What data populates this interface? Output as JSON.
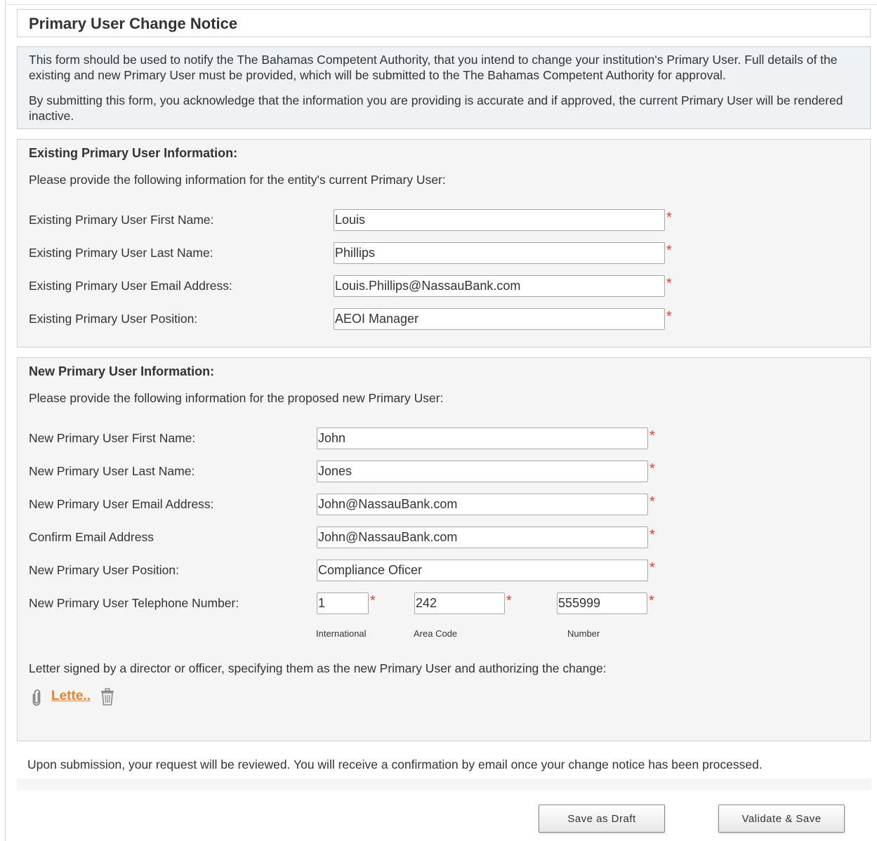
{
  "page_title": "Primary User Change Notice",
  "intro": {
    "para1": "This form should be used to notify the The Bahamas Competent Authority, that you intend to change your institution's Primary User. Full details of the existing and new Primary User must be provided, which will be submitted to the The Bahamas Competent Authority for approval.",
    "para2": "By submitting this form, you acknowledge that the information you are providing is accurate and if approved, the current Primary User will be rendered inactive."
  },
  "existing": {
    "heading": "Existing Primary User Information:",
    "instruction": "Please provide the following information for the entity's current Primary User:",
    "fields": [
      {
        "label": "Existing Primary User First Name:",
        "value": "Louis"
      },
      {
        "label": "Existing Primary User Last Name:",
        "value": "Phillips"
      },
      {
        "label": "Existing Primary User Email Address:",
        "value": "Louis.Phillips@NassauBank.com"
      },
      {
        "label": "Existing Primary User Position:",
        "value": "AEOI Manager"
      }
    ]
  },
  "new_user": {
    "heading": "New Primary User Information:",
    "instruction": "Please provide the following information for the proposed new Primary User:",
    "fields": [
      {
        "label": "New Primary User First Name:",
        "value": "John"
      },
      {
        "label": "New Primary User Last Name:",
        "value": "Jones"
      },
      {
        "label": "New Primary User Email Address:",
        "value": "John@NassauBank.com"
      },
      {
        "label": "Confirm Email Address",
        "value": "John@NassauBank.com"
      },
      {
        "label": "New Primary User Position:",
        "value": "Compliance Oficer"
      }
    ],
    "phone": {
      "label": "New Primary User Telephone Number:",
      "international": "1",
      "area_code": "242",
      "number": "555999",
      "international_label": "International",
      "area_code_label": "Area Code",
      "number_label": "Number"
    },
    "letter_label": "Letter signed by a director or officer, specifying them as the new Primary User and authorizing the change:",
    "attachment_name": "Lette.."
  },
  "required_marker": "*",
  "footer_note": "Upon submission, your request will be reviewed. You will receive a confirmation by email once your change notice has been processed.",
  "buttons": {
    "save_draft": "Save as Draft",
    "validate_save": "Validate & Save"
  },
  "colors": {
    "required_star": "#e53935",
    "link": "#e8822a",
    "info_background": "#eef2f5",
    "section_background": "#f5f5f5"
  }
}
